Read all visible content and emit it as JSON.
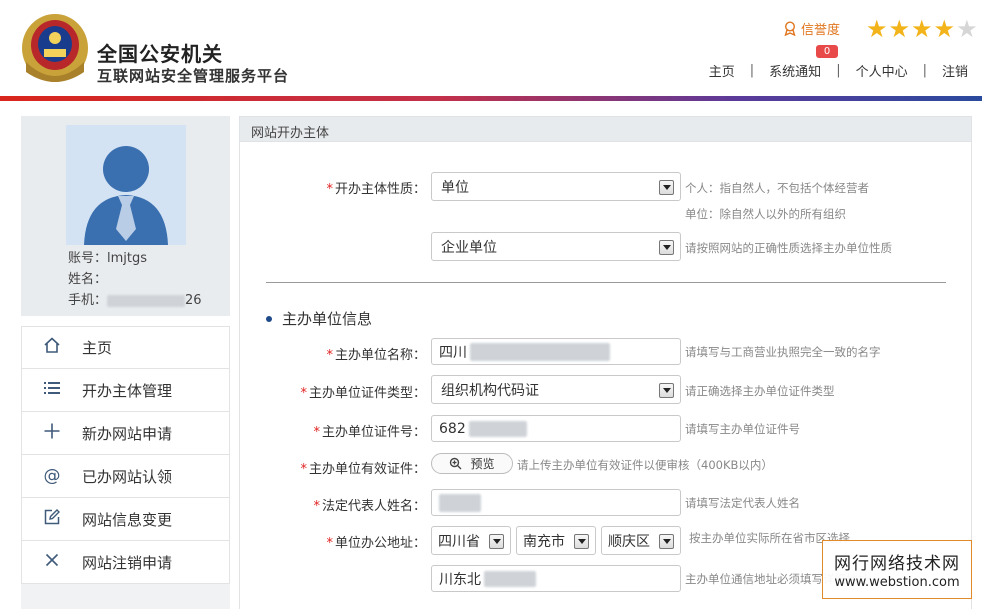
{
  "header": {
    "title_line1": "全国公安机关",
    "title_line2": "互联网站安全管理服务平台",
    "credit_label": "信誉度",
    "rating": 4,
    "rating_max": 5,
    "notification_count": "0",
    "nav": [
      {
        "label": "主页"
      },
      {
        "label": "系统通知"
      },
      {
        "label": "个人中心"
      },
      {
        "label": "注销"
      }
    ]
  },
  "profile": {
    "account_label": "账号：",
    "account_value": "lmjtgs",
    "name_label": "姓名：",
    "phone_label": "手机：",
    "phone_suffix": "26"
  },
  "menu": [
    {
      "icon": "home-icon",
      "label": "主页"
    },
    {
      "icon": "list-icon",
      "label": "开办主体管理"
    },
    {
      "icon": "plus-icon",
      "label": "新办网站申请"
    },
    {
      "icon": "at-icon",
      "label": "已办网站认领"
    },
    {
      "icon": "edit-icon",
      "label": "网站信息变更"
    },
    {
      "icon": "close-icon",
      "label": "网站注销申请"
    }
  ],
  "main": {
    "panel_title": "网站开办主体",
    "nature_label": "开办主体性质：",
    "nature_value": "单位",
    "nature_hint1": "个人：指自然人，不包括个体经营者",
    "nature_hint2": "单位：除自然人以外的所有组织",
    "subtype_value": "企业单位",
    "subtype_hint": "请按照网站的正确性质选择主办单位性质",
    "section_title": "主办单位信息",
    "org_name_label": "主办单位名称：",
    "org_name_value": "四川",
    "org_name_hint": "请填写与工商营业执照完全一致的名字",
    "cert_type_label": "主办单位证件类型：",
    "cert_type_value": "组织机构代码证",
    "cert_type_hint": "请正确选择主办单位证件类型",
    "cert_no_label": "主办单位证件号：",
    "cert_no_value": "682",
    "cert_no_hint": "请填写主办单位证件号",
    "cert_file_label": "主办单位有效证件：",
    "preview_label": "预览",
    "cert_file_hint": "请上传主办单位有效证件以便审核（400KB以内）",
    "legal_label": "法定代表人姓名：",
    "legal_hint": "请填写法定代表人姓名",
    "address_label": "单位办公地址：",
    "province": "四川省",
    "city": "南充市",
    "district": "顺庆区",
    "address_hint": "按主办单位实际所在省市区选择",
    "address_detail": "川东北",
    "address_detail_hint": "主办单位通信地址必须填写详细地址"
  },
  "watermark": {
    "line1": "网行网络技术网",
    "line2": "www.webstion.com"
  }
}
